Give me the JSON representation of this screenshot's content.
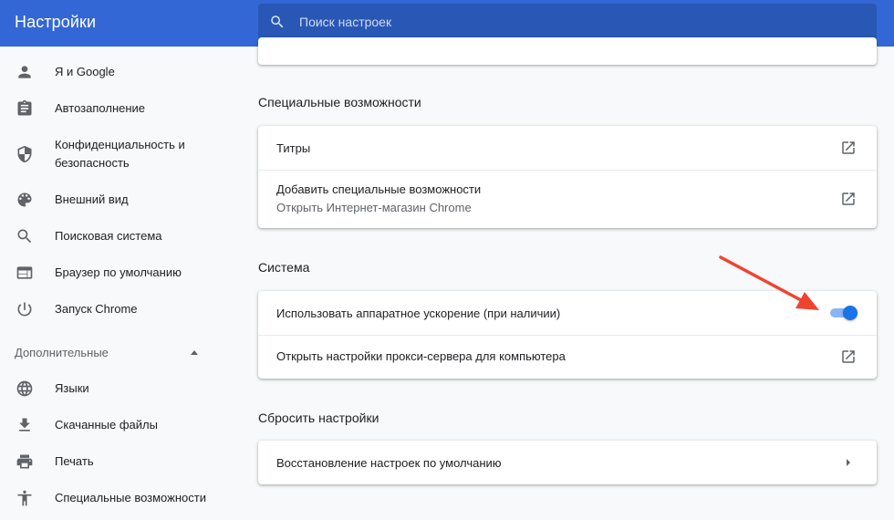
{
  "header": {
    "title": "Настройки",
    "search_placeholder": "Поиск настроек"
  },
  "sidebar": {
    "items": [
      {
        "label": "Я и Google",
        "icon": "person-icon"
      },
      {
        "label": "Автозаполнение",
        "icon": "clipboard-icon"
      },
      {
        "label": "Конфиденциальность и",
        "label2": "безопасность",
        "icon": "shield-icon"
      },
      {
        "label": "Внешний вид",
        "icon": "palette-icon"
      },
      {
        "label": "Поисковая система",
        "icon": "search-icon"
      },
      {
        "label": "Браузер по умолчанию",
        "icon": "browser-icon"
      },
      {
        "label": "Запуск Chrome",
        "icon": "power-icon"
      }
    ],
    "advanced_label": "Дополнительные",
    "advanced_items": [
      {
        "label": "Языки",
        "icon": "globe-icon"
      },
      {
        "label": "Скачанные файлы",
        "icon": "download-icon"
      },
      {
        "label": "Печать",
        "icon": "print-icon"
      },
      {
        "label": "Специальные возможности",
        "icon": "accessibility-icon"
      }
    ]
  },
  "main": {
    "accessibility": {
      "title": "Специальные возможности",
      "captions": "Титры",
      "add_features": "Добавить специальные возможности",
      "add_features_sub": "Открыть Интернет-магазин Chrome"
    },
    "system": {
      "title": "Система",
      "hw_accel": "Использовать аппаратное ускорение (при наличии)",
      "hw_accel_enabled": true,
      "proxy": "Открыть настройки прокси-сервера для компьютера"
    },
    "reset": {
      "title": "Сбросить настройки",
      "restore": "Восстановление настроек по умолчанию"
    }
  },
  "colors": {
    "header": "#3367d6",
    "accent": "#1a73e8",
    "annotation_arrow": "#f0432f"
  }
}
